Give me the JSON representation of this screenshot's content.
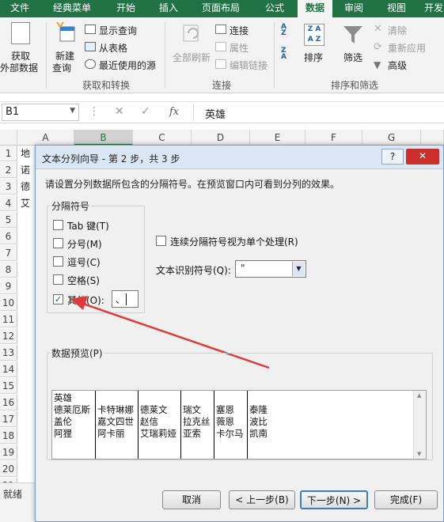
{
  "tabs": [
    "文件",
    "经典菜单",
    "开始",
    "插入",
    "页面布局",
    "公式",
    "数据",
    "审阅",
    "视图",
    "开发"
  ],
  "ribbon": {
    "get_external": [
      "获取",
      "外部数据"
    ],
    "new_query": [
      "新建",
      "查询"
    ],
    "show_queries": "显示查询",
    "from_table": "从表格",
    "recent_sources": "最近使用的源",
    "group_get_transform": "获取和转换",
    "refresh_all": "全部刷新",
    "connections": "连接",
    "properties": "属性",
    "edit_links": "编辑链接",
    "group_connections": "连接",
    "sort": "排序",
    "filter": "筛选",
    "clear": "清除",
    "reapply": "重新应用",
    "advanced": "高级",
    "group_sort_filter": "排序和筛选"
  },
  "formula_bar": {
    "name_box": "B1",
    "fx": "fx",
    "content": "英雄"
  },
  "columns": [
    "A",
    "B",
    "C",
    "D",
    "E",
    "F",
    "G"
  ],
  "rows": [
    "1",
    "2",
    "3",
    "4",
    "5",
    "6",
    "7",
    "8",
    "9",
    "10",
    "11",
    "12",
    "13",
    "14",
    "15",
    "16",
    "17",
    "18",
    "19",
    "20",
    "21"
  ],
  "cells_a": [
    "地",
    "诺",
    "德",
    "艾"
  ],
  "status": "就绪",
  "dialog": {
    "title": "文本分列向导 - 第 2 步，共 3 步",
    "help": "?",
    "close": "✕",
    "instruction": "请设置分列数据所包含的分隔符号。在预览窗口内可看到分列的效果。",
    "delim_group": "分隔符号",
    "delimiters": [
      {
        "label": "Tab 键(T)",
        "checked": false
      },
      {
        "label": "分号(M)",
        "checked": false
      },
      {
        "label": "逗号(C)",
        "checked": false
      },
      {
        "label": "空格(S)",
        "checked": false
      },
      {
        "label": "其他(O):",
        "checked": true
      }
    ],
    "other_value": "、",
    "consecutive_label": "连续分隔符号视为单个处理(R)",
    "qualifier_label": "文本识别符号(Q):",
    "qualifier_value": "\"",
    "preview_label": "数据预览(P)",
    "preview_columns": [
      [
        "英雄",
        "德莱厄斯",
        "盖伦",
        "阿狸"
      ],
      [
        "",
        "卡特琳娜",
        "嘉文四世",
        "阿卡丽"
      ],
      [
        "",
        "德莱文",
        "赵信",
        "艾瑞莉娅"
      ],
      [
        "",
        "瑞文",
        "拉克丝",
        "亚索"
      ],
      [
        "",
        "塞恩",
        "薇恩",
        "卡尔马"
      ],
      [
        "",
        "泰隆",
        "波比",
        "凯南"
      ]
    ],
    "buttons": {
      "cancel": "取消",
      "back": "< 上一步(B)",
      "next": "下一步(N) >",
      "finish": "完成(F)"
    }
  },
  "colors": {
    "excel_green": "#217346",
    "arrow_red": "#e03a3a"
  }
}
